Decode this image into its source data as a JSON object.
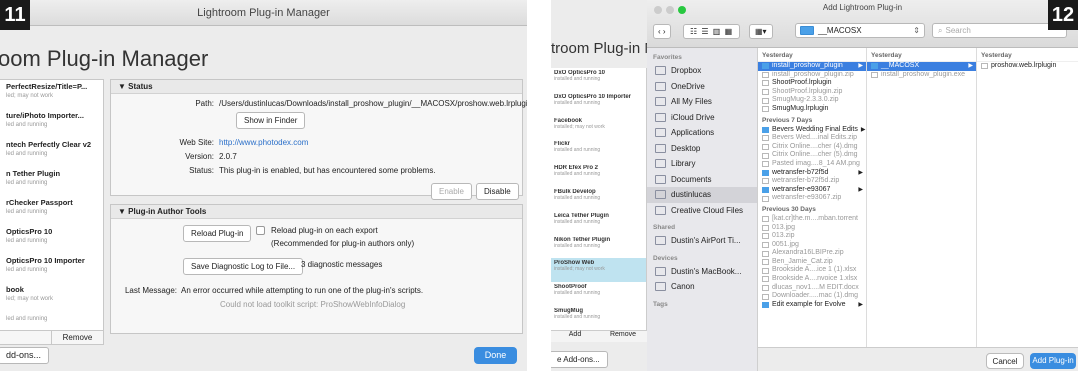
{
  "left": {
    "badge": "11",
    "window_title": "Lightroom Plug-in Manager",
    "page_title": "oom Plug-in Manager",
    "plugins": [
      {
        "name": "PerfectResize/Title=P...",
        "status": "led; may not work"
      },
      {
        "name": "ture/iPhoto Importer...",
        "status": "led and running"
      },
      {
        "name": "ntech Perfectly Clear v2",
        "status": "led and running"
      },
      {
        "name": "n Tether Plugin",
        "status": "led and running"
      },
      {
        "name": "rChecker Passport",
        "status": "led and running"
      },
      {
        "name": "OpticsPro 10",
        "status": "led and running"
      },
      {
        "name": "OpticsPro 10 Importer",
        "status": "led and running"
      },
      {
        "name": "book",
        "status": "led; may not work"
      },
      {
        "name": "",
        "status": "led and running"
      }
    ],
    "remove_label": "Remove",
    "addons_label": "dd-ons...",
    "done_label": "Done",
    "status_section": {
      "title": "▼ Status",
      "path_label": "Path:",
      "path_value": "/Users/dustinlucas/Downloads/install_proshow_plugin/__MACOSX/proshow.web.lrplugin",
      "show_in_finder": "Show in Finder",
      "website_label": "Web Site:",
      "website_value": "http://www.photodex.com",
      "version_label": "Version:",
      "version_value": "2.0.7",
      "status_label": "Status:",
      "status_value": "This plug-in is enabled, but has encountered some problems.",
      "enable_label": "Enable",
      "disable_label": "Disable"
    },
    "author_section": {
      "title": "▼ Plug-in Author Tools",
      "reload_label": "Reload Plug-in",
      "reload_each_label": "Reload plug-in on each export",
      "reload_each_note": "(Recommended for plug-in authors only)",
      "save_log_label": "Save Diagnostic Log to File...",
      "diag_count": "3 diagnostic messages",
      "last_msg_label": "Last Message:",
      "last_msg_value": "An error occurred while attempting to run one of the plug-in's scripts.",
      "last_msg_detail": "Could not load toolkit script: ProShowWebInfoDialog"
    }
  },
  "right": {
    "badge": "12",
    "bg_title": "troom Plug-in M",
    "bg_plugins": [
      {
        "name": "DxO OpticsPro 10",
        "status": "installed and running"
      },
      {
        "name": "DxO OpticsPro 10 Importer",
        "status": "installed and running"
      },
      {
        "name": "Facebook",
        "status": "installed; may not work"
      },
      {
        "name": "Flickr",
        "status": "installed and running"
      },
      {
        "name": "HDR Efex Pro 2",
        "status": "installed and running"
      },
      {
        "name": "FBulk Develop",
        "status": "installed and running"
      },
      {
        "name": "Leica Tether Plugin",
        "status": "installed and running"
      },
      {
        "name": "Nikon Tether Plugin",
        "status": "installed and running"
      },
      {
        "name": "ProShow Web",
        "status": "installed; may not work"
      },
      {
        "name": "ShootProof",
        "status": "installed and running"
      },
      {
        "name": "SmugMug",
        "status": "installed and running"
      }
    ],
    "bg_add_label": "Add",
    "bg_remove_label": "Remove",
    "bg_addons_label": "e Add-ons...",
    "dialog_title": "Add Lightroom Plug-in",
    "location_value": "__MACOSX",
    "search_placeholder": "Search",
    "sidebar": {
      "favorites_header": "Favorites",
      "favorites": [
        "Dropbox",
        "OneDrive",
        "All My Files",
        "iCloud Drive",
        "Applications",
        "Desktop",
        "Library",
        "Documents",
        "dustinlucas",
        "Creative Cloud Files"
      ],
      "selected_favorite": "dustinlucas",
      "shared_header": "Shared",
      "shared": [
        "Dustin's AirPort Ti..."
      ],
      "devices_header": "Devices",
      "devices": [
        "Dustin's MacBook...",
        "Canon"
      ],
      "tags_header": "Tags"
    },
    "col1": {
      "header": "Yesterday",
      "groups": [
        {
          "title": "",
          "items": [
            {
              "name": "install_proshow_plugin",
              "kind": "folder",
              "dark": true,
              "sel": true,
              "arrow": "▶"
            },
            {
              "name": "install_proshow_plugin.zip",
              "kind": "file",
              "dark": false,
              "sel": false,
              "arrow": ""
            },
            {
              "name": "ShootProof.lrplugin",
              "kind": "file",
              "dark": true,
              "sel": false,
              "arrow": ""
            },
            {
              "name": "ShootProof.lrplugin.zip",
              "kind": "file",
              "dark": false,
              "sel": false,
              "arrow": ""
            },
            {
              "name": "SmugMug-2.3.3.0.zip",
              "kind": "file",
              "dark": false,
              "sel": false,
              "arrow": ""
            },
            {
              "name": "SmugMug.lrplugin",
              "kind": "file",
              "dark": true,
              "sel": false,
              "arrow": ""
            }
          ]
        },
        {
          "title": "Previous 7 Days",
          "items": [
            {
              "name": "Bevers Wedding Final Edits",
              "kind": "folder",
              "dark": true,
              "sel": false,
              "arrow": "▶"
            },
            {
              "name": "Bevers Wed....inal Edits.zip",
              "kind": "file",
              "dark": false,
              "sel": false,
              "arrow": ""
            },
            {
              "name": "Citrix Online....cher (4).dmg",
              "kind": "file",
              "dark": false,
              "sel": false,
              "arrow": ""
            },
            {
              "name": "Citrix Online....cher (5).dmg",
              "kind": "file",
              "dark": false,
              "sel": false,
              "arrow": ""
            },
            {
              "name": "Pasted imag....8_14 AM.png",
              "kind": "file",
              "dark": false,
              "sel": false,
              "arrow": ""
            },
            {
              "name": "wetransfer-b72f5d",
              "kind": "folder",
              "dark": true,
              "sel": false,
              "arrow": "▶"
            },
            {
              "name": "wetransfer-b72f5d.zip",
              "kind": "file",
              "dark": false,
              "sel": false,
              "arrow": ""
            },
            {
              "name": "wetransfer-e93067",
              "kind": "folder",
              "dark": true,
              "sel": false,
              "arrow": "▶"
            },
            {
              "name": "wetransfer-e93067.zip",
              "kind": "file",
              "dark": false,
              "sel": false,
              "arrow": ""
            }
          ]
        },
        {
          "title": "Previous 30 Days",
          "items": [
            {
              "name": "[kat.cr]the.m....mban.torrent",
              "kind": "file",
              "dark": false,
              "sel": false,
              "arrow": ""
            },
            {
              "name": "013.jpg",
              "kind": "file",
              "dark": false,
              "sel": false,
              "arrow": ""
            },
            {
              "name": "013.zip",
              "kind": "file",
              "dark": false,
              "sel": false,
              "arrow": ""
            },
            {
              "name": "0051.jpg",
              "kind": "file",
              "dark": false,
              "sel": false,
              "arrow": ""
            },
            {
              "name": "Alexandra16LBIPre.zip",
              "kind": "file",
              "dark": false,
              "sel": false,
              "arrow": ""
            },
            {
              "name": "Ben_Jamie_Cat.zip",
              "kind": "file",
              "dark": false,
              "sel": false,
              "arrow": ""
            },
            {
              "name": "Brookside A....ice 1 (1).xlsx",
              "kind": "file",
              "dark": false,
              "sel": false,
              "arrow": ""
            },
            {
              "name": "Brookside A....nvoice 1.xlsx",
              "kind": "file",
              "dark": false,
              "sel": false,
              "arrow": ""
            },
            {
              "name": "dlucas_nov1....M EDIT.docx",
              "kind": "file",
              "dark": false,
              "sel": false,
              "arrow": ""
            },
            {
              "name": "Downloader.....mac (1).dmg",
              "kind": "file",
              "dark": false,
              "sel": false,
              "arrow": ""
            },
            {
              "name": "Edit example for Evolve",
              "kind": "folder",
              "dark": true,
              "sel": false,
              "arrow": "▶"
            }
          ]
        }
      ]
    },
    "col2": {
      "header": "Yesterday",
      "items": [
        {
          "name": "__MACOSX",
          "kind": "folder",
          "dark": true,
          "sel": true,
          "arrow": "▶"
        },
        {
          "name": "install_proshow_plugin.exe",
          "kind": "file",
          "dark": false,
          "sel": false,
          "arrow": ""
        }
      ]
    },
    "col3": {
      "header": "Yesterday",
      "items": [
        {
          "name": "proshow.web.lrplugin",
          "kind": "file",
          "dark": true,
          "sel": false,
          "arrow": ""
        }
      ]
    },
    "cancel_label": "Cancel",
    "add_plugin_label": "Add Plug-in"
  }
}
